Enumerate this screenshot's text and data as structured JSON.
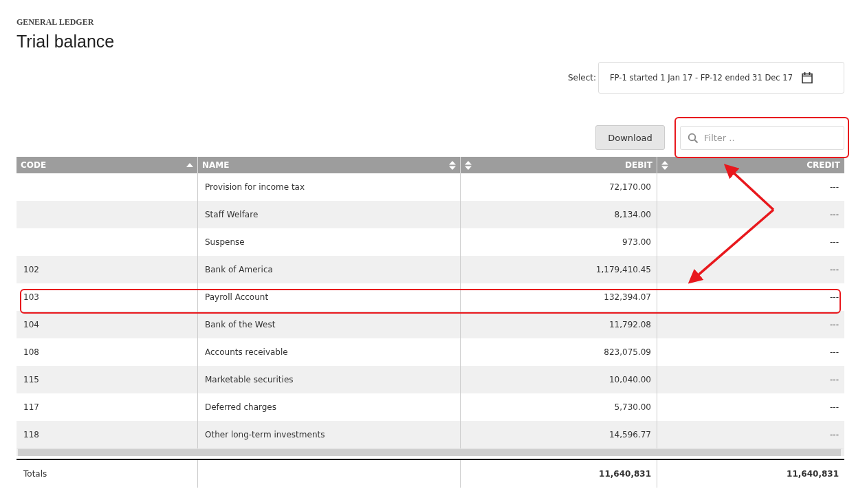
{
  "header": {
    "section": "GENERAL LEDGER",
    "title": "Trial balance"
  },
  "period": {
    "label": "Select:",
    "value": "FP-1 started 1 Jan 17 - FP-12 ended 31 Dec 17"
  },
  "toolbar": {
    "download": "Download",
    "filter": {
      "placeholder": "Filter .."
    }
  },
  "table": {
    "columns": [
      {
        "label": "CODE",
        "sorted": true,
        "kind": "text"
      },
      {
        "label": "NAME",
        "sorted": false,
        "kind": "text"
      },
      {
        "label": "DEBIT",
        "sorted": false,
        "kind": "amount"
      },
      {
        "label": "CREDIT",
        "sorted": false,
        "kind": "amount"
      }
    ],
    "rows": [
      {
        "code": "",
        "name": "Provision for income tax",
        "debit": "72,170.00",
        "credit": "---"
      },
      {
        "code": "",
        "name": "Staff Welfare",
        "debit": "8,134.00",
        "credit": "---"
      },
      {
        "code": "",
        "name": "Suspense",
        "debit": "973.00",
        "credit": "---"
      },
      {
        "code": "102",
        "name": "Bank of America",
        "debit": "1,179,410.45",
        "credit": "---"
      },
      {
        "code": "103",
        "name": "Payroll Account",
        "debit": "132,394.07",
        "credit": "---"
      },
      {
        "code": "104",
        "name": "Bank of the West",
        "debit": "11,792.08",
        "credit": "---"
      },
      {
        "code": "108",
        "name": "Accounts receivable",
        "debit": "823,075.09",
        "credit": "---"
      },
      {
        "code": "115",
        "name": "Marketable securities",
        "debit": "10,040.00",
        "credit": "---"
      },
      {
        "code": "117",
        "name": "Deferred charges",
        "debit": "5,730.00",
        "credit": "---"
      },
      {
        "code": "118",
        "name": "Other long-term investments",
        "debit": "14,596.77",
        "credit": "---"
      }
    ],
    "totals": {
      "label": "Totals",
      "debit": "11,640,831",
      "credit": "11,640,831"
    }
  }
}
